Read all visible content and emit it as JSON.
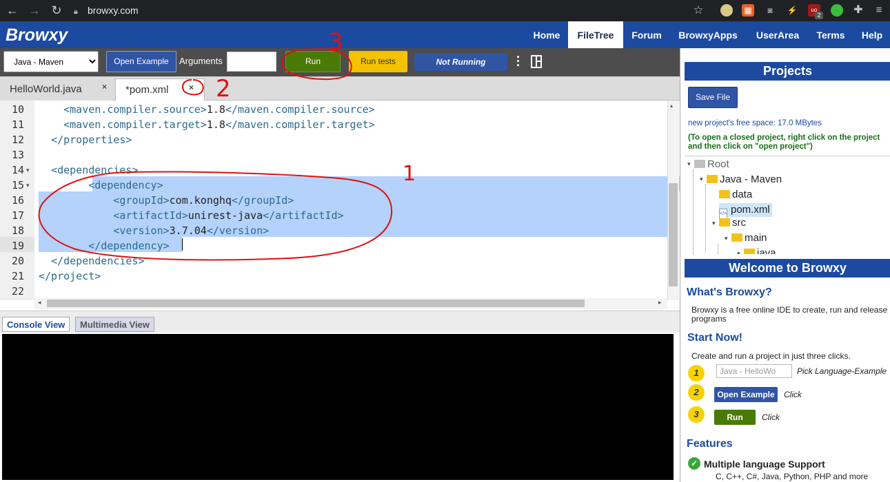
{
  "browser": {
    "url": "browxy.com",
    "icons": [
      "back-icon",
      "forward-icon",
      "reload-icon",
      "lock-icon",
      "star-icon",
      "extension-icon",
      "menu-icon"
    ],
    "badge_count": "2"
  },
  "site": {
    "logo": "Browxy",
    "nav": [
      "Home",
      "FileTree",
      "Forum",
      "BrowxyApps",
      "UserArea",
      "Terms",
      "Help"
    ],
    "active_nav": "FileTree"
  },
  "toolbar": {
    "language": "Java - Maven",
    "open_example": "Open Example",
    "arguments_label": "Arguments",
    "arguments_value": "",
    "run": "Run",
    "run_tests": "Run tests",
    "status": "Not Running",
    "colors": {
      "run": "#4a7a06",
      "run_tests": "#f5c200",
      "status": "#2f55a4"
    }
  },
  "tabs": [
    {
      "label": "HelloWorld.java",
      "close": "×",
      "active": false
    },
    {
      "label": "*pom.xml",
      "close": "×",
      "active": true
    }
  ],
  "editor": {
    "lines": [
      {
        "n": "10",
        "parts": [
          [
            "",
            "    "
          ],
          [
            "tag",
            "<maven.compiler.source>"
          ],
          [
            "",
            "1.8"
          ],
          [
            "tag",
            "</maven.compiler.source>"
          ]
        ]
      },
      {
        "n": "11",
        "parts": [
          [
            "",
            "    "
          ],
          [
            "tag",
            "<maven.compiler.target>"
          ],
          [
            "",
            "1.8"
          ],
          [
            "tag",
            "</maven.compiler.target>"
          ]
        ]
      },
      {
        "n": "12",
        "parts": [
          [
            "",
            "  "
          ],
          [
            "tag",
            "</properties>"
          ]
        ]
      },
      {
        "n": "13",
        "parts": []
      },
      {
        "n": "14",
        "fold": true,
        "parts": [
          [
            "",
            "  "
          ],
          [
            "tag",
            "<dependencies>"
          ]
        ]
      },
      {
        "n": "15",
        "fold": true,
        "parts": [
          [
            "",
            "        "
          ],
          [
            "tag",
            "<dependency>"
          ]
        ]
      },
      {
        "n": "16",
        "parts": [
          [
            "",
            "            "
          ],
          [
            "tag",
            "<groupId>"
          ],
          [
            "",
            "com.konghq"
          ],
          [
            "tag",
            "</groupId>"
          ]
        ]
      },
      {
        "n": "17",
        "parts": [
          [
            "",
            "            "
          ],
          [
            "tag",
            "<artifactId>"
          ],
          [
            "",
            "unirest-java"
          ],
          [
            "tag",
            "</artifactId>"
          ]
        ]
      },
      {
        "n": "18",
        "parts": [
          [
            "",
            "            "
          ],
          [
            "tag",
            "<version>"
          ],
          [
            "",
            "3.7.04"
          ],
          [
            "tag",
            "</version>"
          ]
        ]
      },
      {
        "n": "19",
        "parts": [
          [
            "",
            "        "
          ],
          [
            "tag",
            "</dependency>"
          ]
        ]
      },
      {
        "n": "20",
        "parts": [
          [
            "",
            "  "
          ],
          [
            "tag",
            "</dependencies>"
          ]
        ]
      },
      {
        "n": "21",
        "parts": [
          [
            "tag",
            "</project>"
          ]
        ]
      },
      {
        "n": "22",
        "parts": []
      }
    ]
  },
  "console": {
    "tabs": [
      "Console View",
      "Multimedia View"
    ]
  },
  "projects": {
    "title": "Projects",
    "save_file": "Save File",
    "free_space": "new project's free space: 17.0 MBytes",
    "hint": "(To open a closed project, right click on the project and then click on \"open project\")",
    "tree": [
      {
        "label": "Root",
        "depth": 0,
        "type": "folder-grey"
      },
      {
        "label": "Java - Maven",
        "depth": 1,
        "type": "folder"
      },
      {
        "label": "data",
        "depth": 2,
        "type": "folder"
      },
      {
        "label": "pom.xml",
        "depth": 2,
        "type": "file",
        "selected": true
      },
      {
        "label": "src",
        "depth": 2,
        "type": "folder"
      },
      {
        "label": "main",
        "depth": 3,
        "type": "folder"
      },
      {
        "label": "java",
        "depth": 4,
        "type": "folder"
      }
    ]
  },
  "welcome": {
    "title": "Welcome to Browxy",
    "whats_title": "What's Browxy?",
    "whats_text": "Browxy is a free online IDE to create, run and release a programs",
    "start_title": "Start Now!",
    "start_text": "Create and run a project in just three clicks.",
    "steps": [
      {
        "num": "1",
        "control": "Java - HelloWo",
        "action": "Pick Language-Example"
      },
      {
        "num": "2",
        "control": "Open Example",
        "action": "Click"
      },
      {
        "num": "3",
        "control": "Run",
        "action": "Click"
      }
    ],
    "features_title": "Features",
    "feature_1_title": "Multiple language Support",
    "feature_1_text": "C, C++, C#, Java, Python, PHP and more"
  },
  "annotations": [
    "1",
    "2",
    "3"
  ]
}
